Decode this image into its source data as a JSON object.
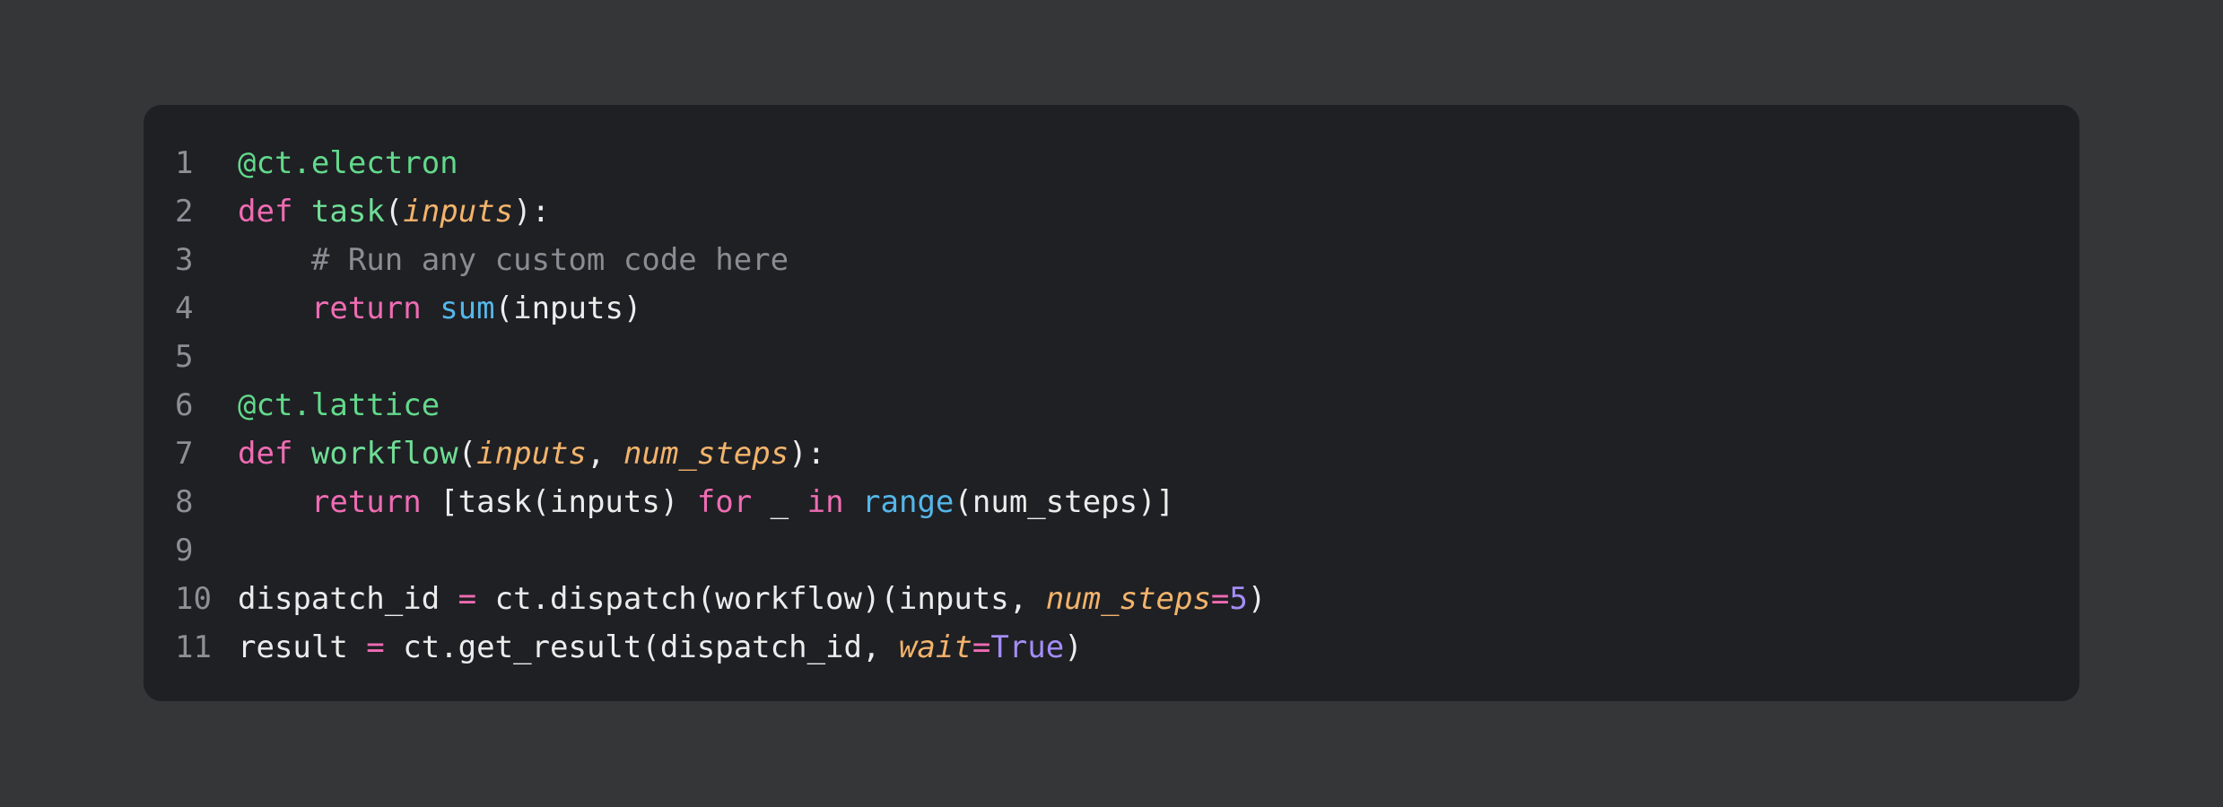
{
  "colors": {
    "page_background": "#353638",
    "editor_background": "#1f2024",
    "line_number": "#8d8f96",
    "decorator": "#62d98b",
    "keyword": "#ef6cb3",
    "function_name": "#6fdd95",
    "parameter": "#f2b36b",
    "builtin": "#54b7ea",
    "comment": "#8a8c93",
    "operator": "#ef6cb3",
    "number_constant": "#a48df7",
    "plain": "#ececec"
  },
  "code": {
    "language": "python",
    "lines": [
      {
        "number": "1",
        "tokens": [
          {
            "type": "decorator",
            "text": "@ct.electron"
          }
        ]
      },
      {
        "number": "2",
        "tokens": [
          {
            "type": "keyword",
            "text": "def"
          },
          {
            "type": "plain",
            "text": " "
          },
          {
            "type": "funcname",
            "text": "task"
          },
          {
            "type": "plain",
            "text": "("
          },
          {
            "type": "param",
            "text": "inputs"
          },
          {
            "type": "plain",
            "text": "):"
          }
        ]
      },
      {
        "number": "3",
        "tokens": [
          {
            "type": "plain",
            "text": "    "
          },
          {
            "type": "comment",
            "text": "# Run any custom code here"
          }
        ]
      },
      {
        "number": "4",
        "tokens": [
          {
            "type": "plain",
            "text": "    "
          },
          {
            "type": "keyword",
            "text": "return"
          },
          {
            "type": "plain",
            "text": " "
          },
          {
            "type": "builtin",
            "text": "sum"
          },
          {
            "type": "plain",
            "text": "(inputs)"
          }
        ]
      },
      {
        "number": "5",
        "tokens": []
      },
      {
        "number": "6",
        "tokens": [
          {
            "type": "decorator",
            "text": "@ct.lattice"
          }
        ]
      },
      {
        "number": "7",
        "tokens": [
          {
            "type": "keyword",
            "text": "def"
          },
          {
            "type": "plain",
            "text": " "
          },
          {
            "type": "funcname",
            "text": "workflow"
          },
          {
            "type": "plain",
            "text": "("
          },
          {
            "type": "param",
            "text": "inputs"
          },
          {
            "type": "plain",
            "text": ", "
          },
          {
            "type": "param",
            "text": "num_steps"
          },
          {
            "type": "plain",
            "text": "):"
          }
        ]
      },
      {
        "number": "8",
        "tokens": [
          {
            "type": "plain",
            "text": "    "
          },
          {
            "type": "keyword",
            "text": "return"
          },
          {
            "type": "plain",
            "text": " [task(inputs) "
          },
          {
            "type": "keyword",
            "text": "for"
          },
          {
            "type": "plain",
            "text": " _ "
          },
          {
            "type": "keyword",
            "text": "in"
          },
          {
            "type": "plain",
            "text": " "
          },
          {
            "type": "builtin",
            "text": "range"
          },
          {
            "type": "plain",
            "text": "(num_steps)]"
          }
        ]
      },
      {
        "number": "9",
        "tokens": []
      },
      {
        "number": "10",
        "tokens": [
          {
            "type": "plain",
            "text": "dispatch_id "
          },
          {
            "type": "operator",
            "text": "="
          },
          {
            "type": "plain",
            "text": " ct.dispatch(workflow)(inputs, "
          },
          {
            "type": "param",
            "text": "num_steps"
          },
          {
            "type": "operator",
            "text": "="
          },
          {
            "type": "number",
            "text": "5"
          },
          {
            "type": "plain",
            "text": ")"
          }
        ]
      },
      {
        "number": "11",
        "tokens": [
          {
            "type": "plain",
            "text": "result "
          },
          {
            "type": "operator",
            "text": "="
          },
          {
            "type": "plain",
            "text": " ct.get_result(dispatch_id, "
          },
          {
            "type": "param",
            "text": "wait"
          },
          {
            "type": "operator",
            "text": "="
          },
          {
            "type": "constant",
            "text": "True"
          },
          {
            "type": "plain",
            "text": ")"
          }
        ]
      }
    ]
  }
}
